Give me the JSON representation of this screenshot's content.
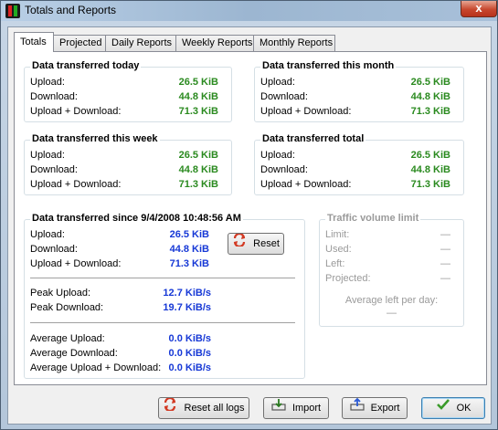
{
  "window": {
    "title": "Totals and Reports",
    "close_glyph": "x"
  },
  "tabs": [
    {
      "label": "Totals"
    },
    {
      "label": "Projected"
    },
    {
      "label": "Daily Reports"
    },
    {
      "label": "Weekly Reports"
    },
    {
      "label": "Monthly Reports"
    }
  ],
  "today": {
    "title": "Data transferred today",
    "upload_label": "Upload:",
    "upload": "26.5 KiB",
    "download_label": "Download:",
    "download": "44.8 KiB",
    "total_label": "Upload + Download:",
    "total": "71.3 KiB"
  },
  "month": {
    "title": "Data transferred this month",
    "upload_label": "Upload:",
    "upload": "26.5 KiB",
    "download_label": "Download:",
    "download": "44.8 KiB",
    "total_label": "Upload + Download:",
    "total": "71.3 KiB"
  },
  "week": {
    "title": "Data transferred this week",
    "upload_label": "Upload:",
    "upload": "26.5 KiB",
    "download_label": "Download:",
    "download": "44.8 KiB",
    "total_label": "Upload + Download:",
    "total": "71.3 KiB"
  },
  "alltime": {
    "title": "Data transferred total",
    "upload_label": "Upload:",
    "upload": "26.5 KiB",
    "download_label": "Download:",
    "download": "44.8 KiB",
    "total_label": "Upload + Download:",
    "total": "71.3 KiB"
  },
  "since": {
    "title": "Data transferred since 9/4/2008 10:48:56 AM",
    "upload_label": "Upload:",
    "upload": "26.5 KiB",
    "download_label": "Download:",
    "download": "44.8 KiB",
    "total_label": "Upload + Download:",
    "total": "71.3 KiB",
    "peak_upload_label": "Peak Upload:",
    "peak_upload": "12.7 KiB/s",
    "peak_download_label": "Peak Download:",
    "peak_download": "19.7 KiB/s",
    "avg_upload_label": "Average Upload:",
    "avg_upload": "0.0 KiB/s",
    "avg_download_label": "Average Download:",
    "avg_download": "0.0 KiB/s",
    "avg_total_label": "Average Upload + Download:",
    "avg_total": "0.0 KiB/s",
    "reset_label": "Reset"
  },
  "limit": {
    "title": "Traffic volume limit",
    "limit_label": "Limit:",
    "limit": "—",
    "used_label": "Used:",
    "used": "—",
    "left_label": "Left:",
    "left": "—",
    "projected_label": "Projected:",
    "projected": "—",
    "avg_left_label": "Average left per day:",
    "avg_left": "—"
  },
  "buttons": {
    "reset_all": "Reset all logs",
    "import": "Import",
    "export": "Export",
    "ok": "OK"
  },
  "colors": {
    "value_green": "#2a8a1f",
    "value_blue": "#1638d6",
    "reset_red": "#d23a24",
    "ok_green": "#3a9a2a"
  }
}
